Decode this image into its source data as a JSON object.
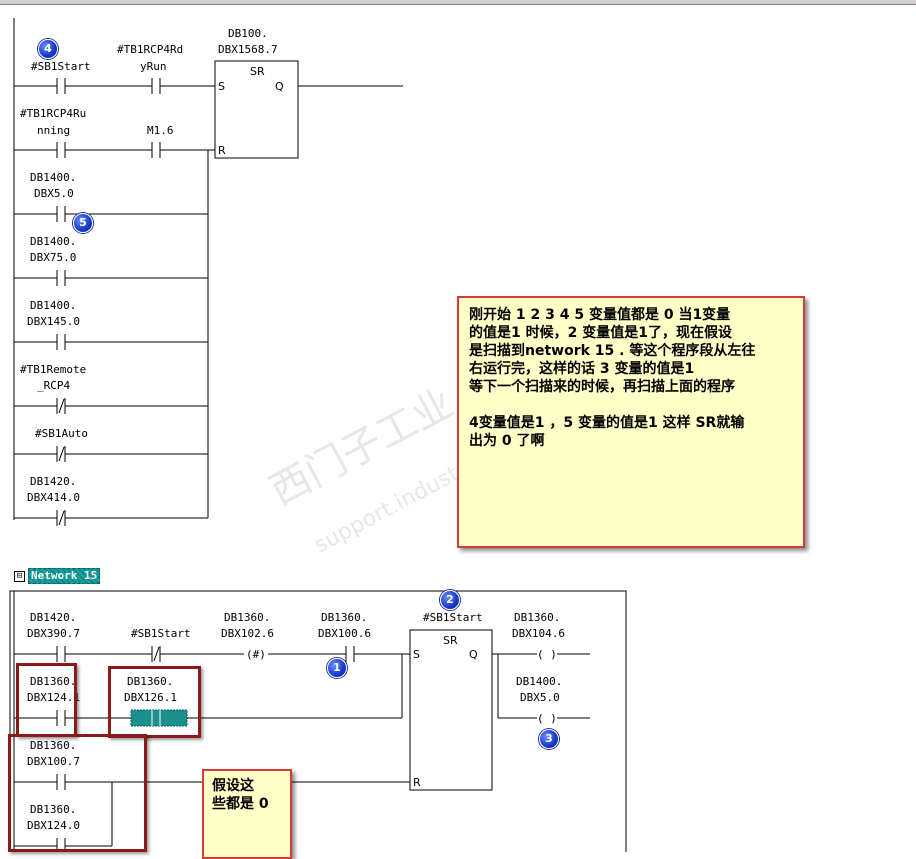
{
  "network14": {
    "rung1": {
      "contact": "#SB1Start",
      "contact2_line1": "#TB1RCP4Rd",
      "contact2_line2": "yRun",
      "coil_line1": "DB100.",
      "coil_line2": "DBX1568.7"
    },
    "sr_title": "SR",
    "sr_s": "S",
    "sr_q": "Q",
    "sr_r": "R",
    "rung2": {
      "contact_line1": "#TB1RCP4Ru",
      "contact_line2": "nning",
      "contact2": "M1.6"
    },
    "branches": [
      {
        "line1": "DB1400.",
        "line2": "DBX5.0"
      },
      {
        "line1": "DB1400.",
        "line2": "DBX75.0"
      },
      {
        "line1": "DB1400.",
        "line2": "DBX145.0"
      },
      {
        "line1": "#TB1Remote",
        "line2": "_RCP4"
      },
      {
        "line1": "#SB1Auto",
        "line2": ""
      },
      {
        "line1": "DB1420.",
        "line2": "DBX414.0"
      }
    ]
  },
  "network15": {
    "title": "Network 15",
    "toggle": "⊟",
    "c1": {
      "line1": "DB1420.",
      "line2": "DBX390.7"
    },
    "c2": "#SB1Start",
    "c3": {
      "line1": "DB1360.",
      "line2": "DBX102.6",
      "symbol": "(#)"
    },
    "c4": {
      "line1": "DB1360.",
      "line2": "DBX100.6"
    },
    "sr_name": "#SB1Start",
    "sr_title": "SR",
    "sr_s": "S",
    "sr_q": "Q",
    "sr_r": "R",
    "coil1": {
      "line1": "DB1360.",
      "line2": "DBX104.6",
      "symbol": "( )"
    },
    "coil2": {
      "line1": "DB1400.",
      "line2": "DBX5.0",
      "symbol": "( )"
    },
    "c5": {
      "line1": "DB1360.",
      "line2": "DBX124.1"
    },
    "c6": {
      "line1": "DB1360.",
      "line2": "DBX126.1"
    },
    "c7": {
      "line1": "DB1360.",
      "line2": "DBX100.7"
    },
    "c8": {
      "line1": "DB1360.",
      "line2": "DBX124.0"
    }
  },
  "badges": [
    "4",
    "5",
    "2",
    "1",
    "3"
  ],
  "note_main": {
    "line1": "刚开始 1 2 3 4 5 变量值都是 0 当1变量",
    "line2": "的值是1 时候，2 变量值是1了，现在假设",
    "line3": "是扫描到network 15 . 等这个程序段从左往",
    "line4": "右运行完，这样的话 3 变量的值是1",
    "line5": "等下一个扫描来的时候，再扫描上面的程序",
    "line6": "4变量值是1 ，5 变量的值是1  这样 SR就输",
    "line7": "出为 0 了啊"
  },
  "note_small": {
    "line1": "假设这",
    "line2": "些都是 0"
  },
  "watermark": {
    "line1": "西门子工业",
    "line2": "support.industry.siemens"
  }
}
